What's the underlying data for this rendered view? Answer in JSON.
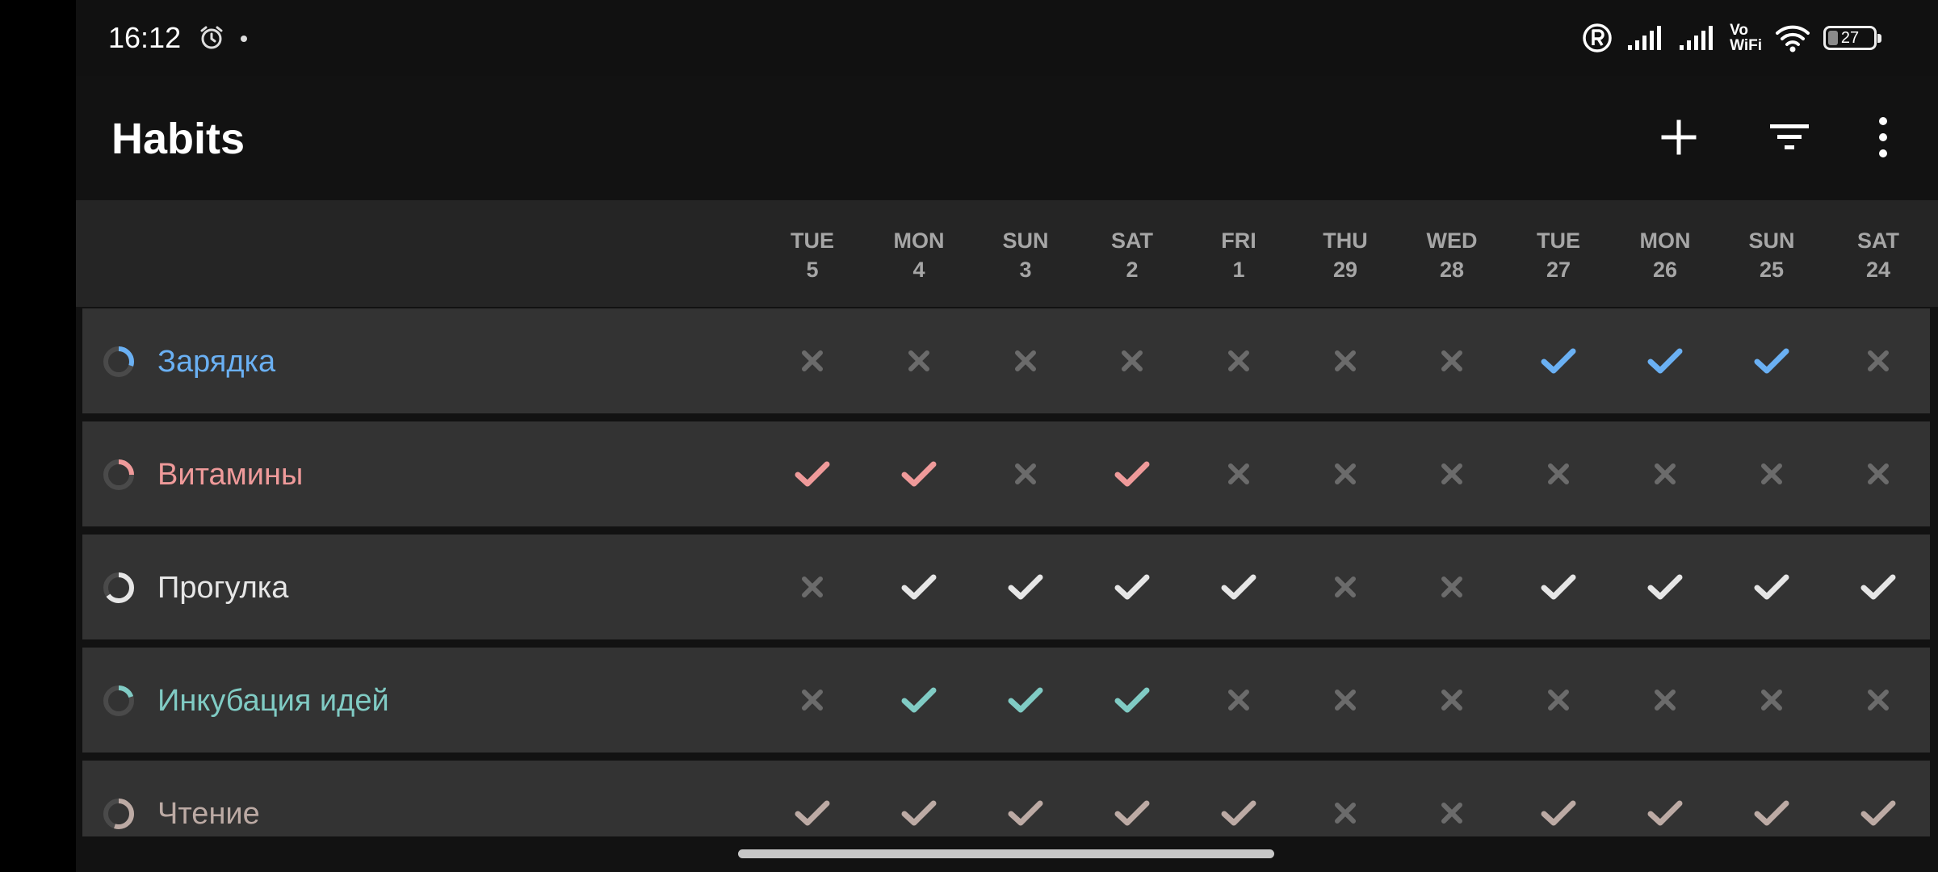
{
  "status_bar": {
    "time": "16:12",
    "icons": [
      "alarm-icon",
      "dot-icon",
      "roaming-r-icon",
      "signal-icon",
      "signal-icon",
      "vowifi-icon",
      "wifi-icon",
      "battery-icon"
    ],
    "vowifi_top": "Vo",
    "vowifi_bottom": "WiFi",
    "battery_level": "27"
  },
  "app_bar": {
    "title": "Habits",
    "actions": [
      "add-icon",
      "filter-icon",
      "more-vert-icon"
    ]
  },
  "days": [
    {
      "dow": "TUE",
      "date": "5"
    },
    {
      "dow": "MON",
      "date": "4"
    },
    {
      "dow": "SUN",
      "date": "3"
    },
    {
      "dow": "SAT",
      "date": "2"
    },
    {
      "dow": "FRI",
      "date": "1"
    },
    {
      "dow": "THU",
      "date": "29"
    },
    {
      "dow": "WED",
      "date": "28"
    },
    {
      "dow": "TUE",
      "date": "27"
    },
    {
      "dow": "MON",
      "date": "26"
    },
    {
      "dow": "SUN",
      "date": "25"
    },
    {
      "dow": "SAT",
      "date": "24"
    }
  ],
  "colors": {
    "unchecked": "#6b6b6b",
    "ring_track": "#4a4a4a"
  },
  "habits": [
    {
      "name": "Зарядка",
      "color": "#6ab0f3",
      "score": 0.3,
      "checks": [
        0,
        0,
        0,
        0,
        0,
        0,
        0,
        1,
        1,
        1,
        0
      ]
    },
    {
      "name": "Витамины",
      "color": "#ef9a9a",
      "score": 0.25,
      "checks": [
        1,
        1,
        0,
        1,
        0,
        0,
        0,
        0,
        0,
        0,
        0
      ]
    },
    {
      "name": "Прогулка",
      "color": "#e6e6e6",
      "score": 0.65,
      "checks": [
        0,
        1,
        1,
        1,
        1,
        0,
        0,
        1,
        1,
        1,
        1
      ]
    },
    {
      "name": "Инкубация идей",
      "color": "#80cbc4",
      "score": 0.2,
      "checks": [
        0,
        1,
        1,
        1,
        0,
        0,
        0,
        0,
        0,
        0,
        0
      ]
    },
    {
      "name": "Чтение",
      "color": "#bcaaa4",
      "score": 0.55,
      "checks": [
        1,
        1,
        1,
        1,
        1,
        0,
        0,
        1,
        1,
        1,
        1
      ]
    }
  ]
}
